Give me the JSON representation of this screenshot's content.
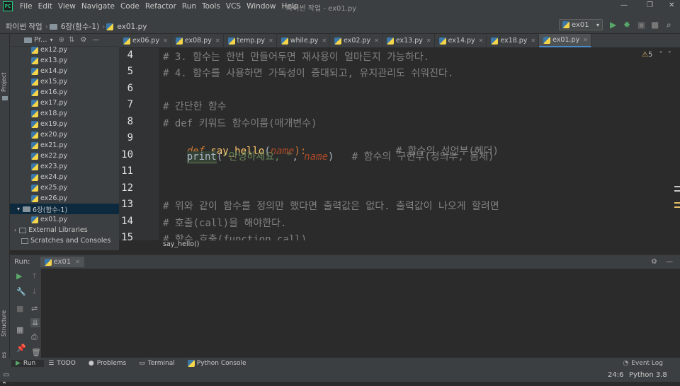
{
  "menubar": {
    "items": [
      "File",
      "Edit",
      "View",
      "Navigate",
      "Code",
      "Refactor",
      "Run",
      "Tools",
      "VCS",
      "Window",
      "Help"
    ],
    "window_title": "파이썬 작업 - ex01.py"
  },
  "navbar": {
    "crumbs": [
      "파이썬 작업",
      "6장(함수-1)",
      "ex01.py"
    ],
    "run_config": "ex01"
  },
  "left_stripe": {
    "project": "Project",
    "structure": "Structure",
    "favorites": "Favorites"
  },
  "project_panel": {
    "header_label": "Pr...",
    "files": [
      "ex12.py",
      "ex13.py",
      "ex14.py",
      "ex15.py",
      "ex16.py",
      "ex17.py",
      "ex18.py",
      "ex19.py",
      "ex20.py",
      "ex21.py",
      "ex22.py",
      "ex23.py",
      "ex24.py",
      "ex25.py",
      "ex26.py"
    ],
    "folder": "6장(함수-1)",
    "folder_file": "ex01.py",
    "external": "External Libraries",
    "scratches": "Scratches and Consoles"
  },
  "tabs": [
    "ex06.py",
    "ex08.py",
    "temp.py",
    "while.py",
    "ex02.py",
    "ex13.py",
    "ex14.py",
    "ex18.py",
    "ex01.py"
  ],
  "active_tab": "ex01.py",
  "editor": {
    "line_numbers": [
      "4",
      "5",
      "6",
      "7",
      "8",
      "9",
      "10",
      "11",
      "12",
      "13",
      "14",
      "15"
    ],
    "line4": "# 3. 함수는 한번 만들어두면 재사용이 얼마든지 가능하다.",
    "line5": "# 4. 함수를 사용하면 가독성이 증대되고, 유지관리도 쉬워진다.",
    "line7": "# 간단한 함수",
    "line8": "# def 키워드 함수이름(매개변수)",
    "line9": {
      "kw": "def",
      "fn": "say_hello",
      "open": "(",
      "param": "name",
      "close": "):",
      "comment": "# 함수의 선언부(헤더)"
    },
    "line10": {
      "builtin": "print",
      "open": "(",
      "str": "\"안녕하세요, \"",
      "sep": ", ",
      "param": "name",
      "close": ")",
      "comment": "# 함수의 구현부(정의부, 몸체)"
    },
    "line13": "# 위와 같이 함수를 정의만 했다면 출력값은 없다. 출력값이 나오게 할려면",
    "line14": "# 호출(call)을 해야한다.",
    "line15": "# 함수 호출(function call)",
    "warning_count": "5",
    "breadcrumb": "say_hello()"
  },
  "run_panel": {
    "label": "Run:",
    "tab": "ex01"
  },
  "bottom_tabs": [
    "Run",
    "TODO",
    "Problems",
    "Terminal",
    "Python Console"
  ],
  "statusbar": {
    "event_log": "Event Log",
    "position": "24:6",
    "interpreter": "Python 3.8"
  },
  "colors": {
    "accent": "#4a88c7",
    "background": "#2b2b2b",
    "panel": "#3c3f41"
  }
}
